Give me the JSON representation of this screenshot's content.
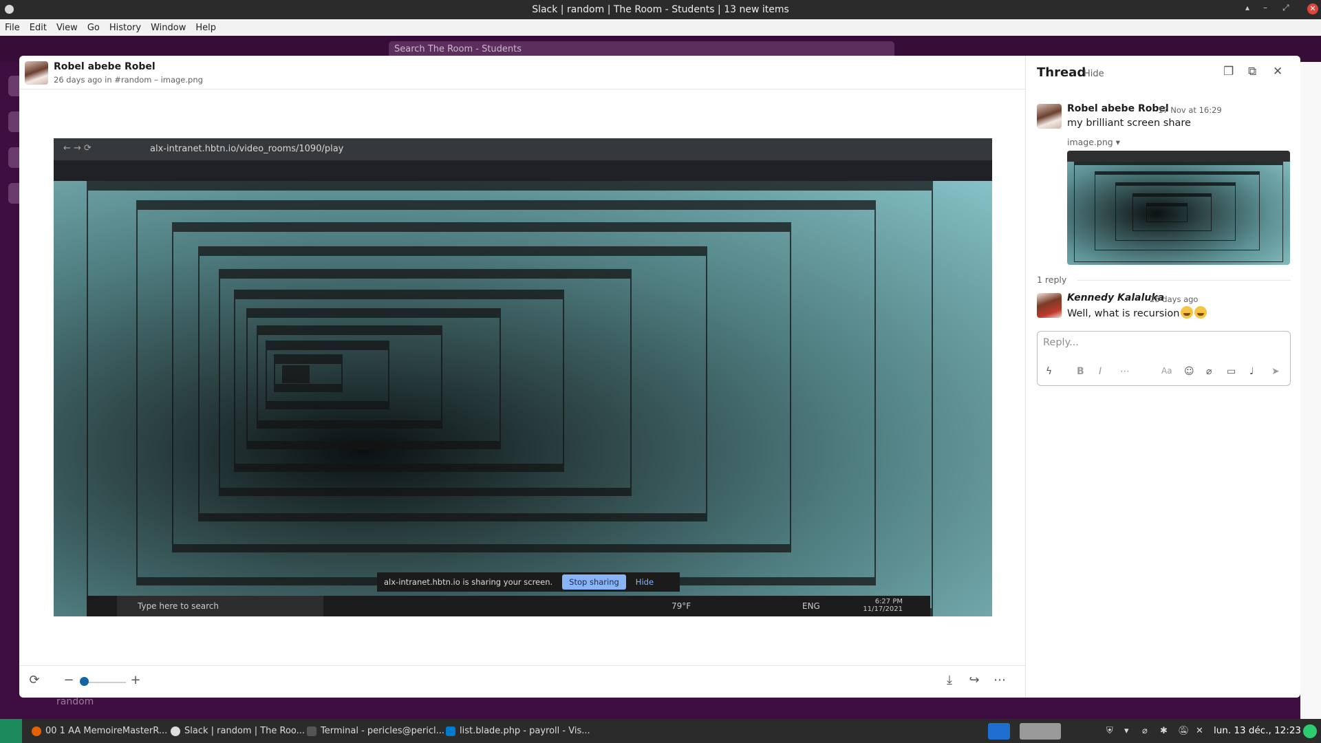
{
  "window": {
    "title": "Slack | random | The Room - Students | 13 new items",
    "controls": [
      "▴",
      "–",
      "⤢"
    ],
    "close": "✕"
  },
  "menubar": [
    "File",
    "Edit",
    "View",
    "Go",
    "History",
    "Window",
    "Help"
  ],
  "slack": {
    "search_placeholder": "Search The Room - Students",
    "behind_channel": "random"
  },
  "viewer": {
    "author": "Robel abebe Robel",
    "meta": "26 days ago in #random  – image.png",
    "screenshot": {
      "url": "alx-intranet.hbtn.io/video_rooms/1090/play",
      "share_text": "alx-intranet.hbtn.io is sharing your screen.",
      "stop_button": "Stop sharing",
      "hide_button": "Hide",
      "taskbar_search": "Type here to search",
      "weather": "79°F",
      "lang": "ENG",
      "clock_time": "6:27 PM",
      "clock_date": "11/17/2021"
    }
  },
  "thread": {
    "title": "Thread",
    "hide_label": "Hide",
    "parent": {
      "author": "Robel abebe Robel",
      "time": "17 Nov at 16:29",
      "text": "my brilliant screen share",
      "file": "image.png ▾"
    },
    "reply_count": "1 reply",
    "reply": {
      "author": "Kennedy Kalaluka",
      "time": "25 days ago",
      "text": "Well, what is recursion"
    },
    "composer_placeholder": "Reply..."
  },
  "taskbar": {
    "items": [
      {
        "label": "00 1 AA MemoireMasterR...",
        "color": "#e66000"
      },
      {
        "label": "Slack | random | The Roo...",
        "color": "#4a154b"
      },
      {
        "label": "Terminal - pericles@pericl...",
        "color": "#555555"
      },
      {
        "label": "list.blade.php - payroll - Vis...",
        "color": "#007acc"
      }
    ],
    "clock": "lun. 13 déc., 12:23"
  },
  "colors": {
    "slack_purple": "#3f0e40",
    "link_blue": "#1264a3",
    "stop_sharing": "#8ab4f8"
  }
}
